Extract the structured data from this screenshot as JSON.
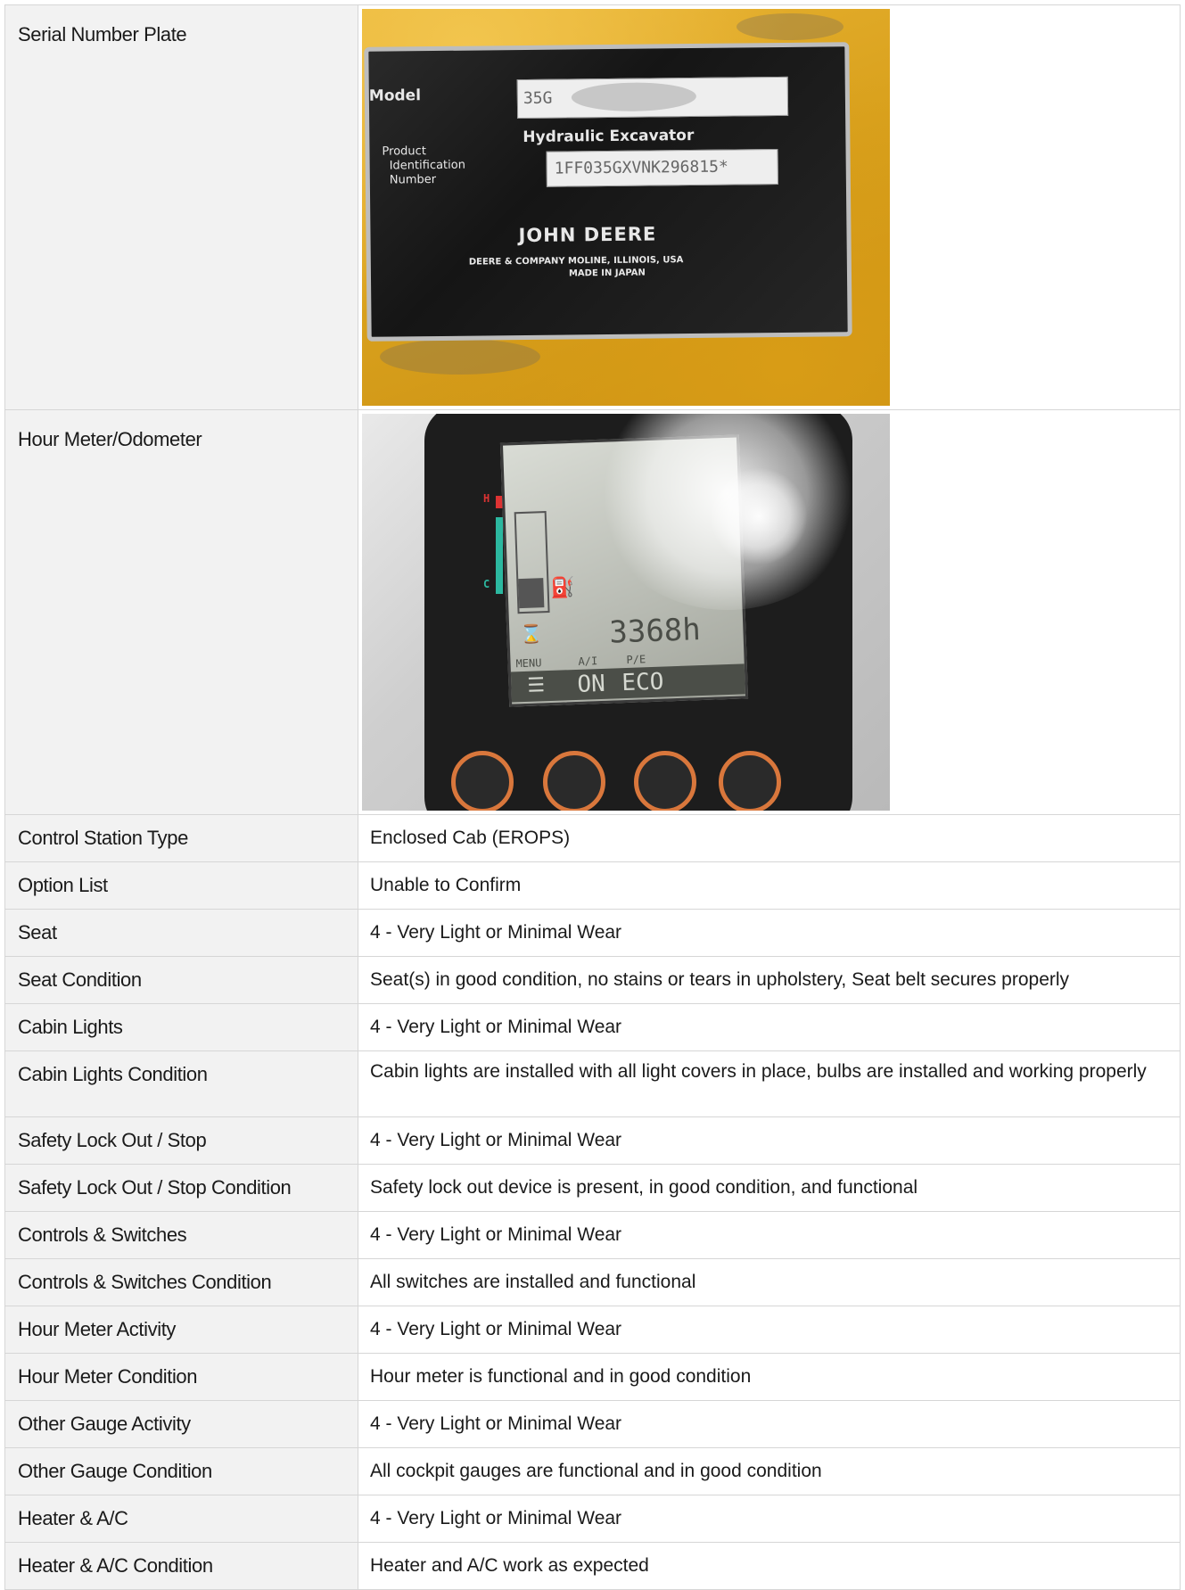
{
  "rows": [
    {
      "label": "Serial Number Plate",
      "photo": "serial-plate"
    },
    {
      "label": "Hour Meter/Odometer",
      "photo": "hour-meter"
    },
    {
      "label": "Control Station Type",
      "value": "Enclosed Cab (EROPS)"
    },
    {
      "label": "Option List",
      "value": "Unable to Confirm"
    },
    {
      "label": "Seat",
      "value": "4 - Very Light or Minimal Wear"
    },
    {
      "label": "Seat Condition",
      "value": "Seat(s) in good condition, no stains or tears in upholstery, Seat belt secures properly"
    },
    {
      "label": "Cabin Lights",
      "value": "4 - Very Light or Minimal Wear"
    },
    {
      "label": "Cabin Lights Condition",
      "value": "Cabin lights are installed with all light covers in place, bulbs are installed and working properly"
    },
    {
      "label": "Safety Lock Out / Stop",
      "value": "4 - Very Light or Minimal Wear"
    },
    {
      "label": "Safety Lock Out / Stop Condition",
      "value": "Safety lock out device is present, in good condition, and functional"
    },
    {
      "label": "Controls & Switches",
      "value": "4 - Very Light or Minimal Wear"
    },
    {
      "label": "Controls & Switches Condition",
      "value": "All switches are installed and functional"
    },
    {
      "label": "Hour Meter Activity",
      "value": "4 - Very Light or Minimal Wear"
    },
    {
      "label": "Hour Meter Condition",
      "value": "Hour meter is functional and in good condition"
    },
    {
      "label": "Other Gauge Activity",
      "value": "4 - Very Light or Minimal Wear"
    },
    {
      "label": "Other Gauge Condition",
      "value": "All cockpit gauges are functional and in good condition"
    },
    {
      "label": "Heater & A/C",
      "value": "4 - Very Light or Minimal Wear"
    },
    {
      "label": "Heater & A/C Condition",
      "value": "Heater and A/C work as expected"
    }
  ],
  "serial_plate": {
    "model_label": "Model",
    "model_value": "35G",
    "product_type": "Hydraulic Excavator",
    "pin_label_1": "Product",
    "pin_label_2": "Identification",
    "pin_label_3": "Number",
    "pin_value": "1FF035GXVNK296815*",
    "brand": "JOHN DEERE",
    "maker_line": "DEERE & COMPANY MOLINE, ILLINOIS, USA",
    "origin_line": "MADE IN JAPAN"
  },
  "hour_meter": {
    "hot_label": "H",
    "cold_label": "C",
    "hours": "3368h",
    "softkey_1": "MENU",
    "softkey_2": "A/I",
    "softkey_3": "P/E",
    "btn_2": "ON",
    "btn_3": "ECO"
  }
}
